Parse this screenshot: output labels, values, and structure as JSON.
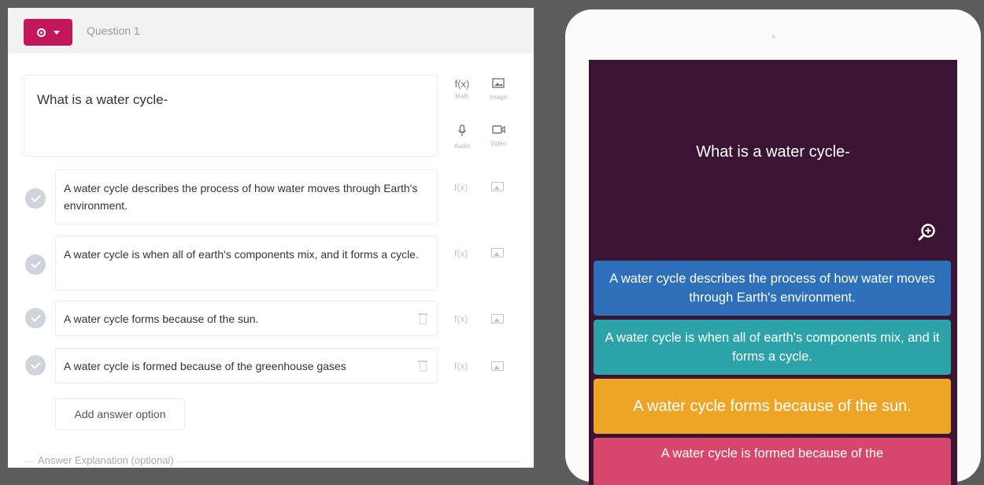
{
  "editor": {
    "question_number": "Question 1",
    "question_text": "What is a water cycle-",
    "tools": [
      {
        "icon": "function-icon",
        "label": "Math"
      },
      {
        "icon": "image-icon",
        "label": "Image"
      },
      {
        "icon": "microphone-icon",
        "label": "Audio"
      },
      {
        "icon": "video-icon",
        "label": "Video"
      }
    ],
    "answers": [
      {
        "text": "A water cycle describes the process of how water moves through Earth's environment."
      },
      {
        "text": "A water cycle is when all of earth's components mix, and it forms a cycle."
      },
      {
        "text": "A water cycle forms because of the sun."
      },
      {
        "text": "A water cycle is formed because of the greenhouse gases"
      }
    ],
    "answer_tool_math": "f(x)",
    "add_answer_label": "Add answer option",
    "explanation_label": "Answer Explanation (optional)"
  },
  "preview": {
    "question_text": "What is a water cycle-",
    "options": [
      {
        "text": "A water cycle describes the process of how water moves through Earth's environment.",
        "color": "#2d70b9"
      },
      {
        "text": "A water cycle is when all of earth's components mix, and it forms a cycle.",
        "color": "#2ba3a8"
      },
      {
        "text": "A water cycle forms because of the sun.",
        "color": "#eea425"
      },
      {
        "text": "A water cycle is formed because of the",
        "color": "#d6476b"
      }
    ]
  },
  "colors": {
    "accent": "#c2185b",
    "preview_background": "#3b1333"
  }
}
